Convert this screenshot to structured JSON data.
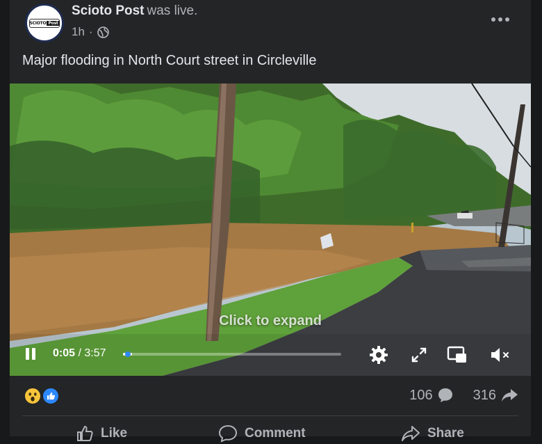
{
  "post": {
    "page_name": "Scioto Post",
    "status_text": "was live.",
    "time_ago": "1h",
    "separator": "·",
    "avatar_text": "SCIOTO",
    "avatar_badge": "Post",
    "caption": "Major flooding in North Court street in Circleville"
  },
  "video": {
    "overlay_text": "Click to expand",
    "current_time": "0:05",
    "duration": "/ 3:57",
    "progress_fraction": 0.021
  },
  "reactions": {
    "comment_count": "106",
    "share_count": "316"
  },
  "actions": {
    "like_label": "Like",
    "comment_label": "Comment",
    "share_label": "Share"
  },
  "colors": {
    "background": "#18191a",
    "card": "#242526",
    "accent": "#2d88ff",
    "wow": "#f7c43b"
  }
}
